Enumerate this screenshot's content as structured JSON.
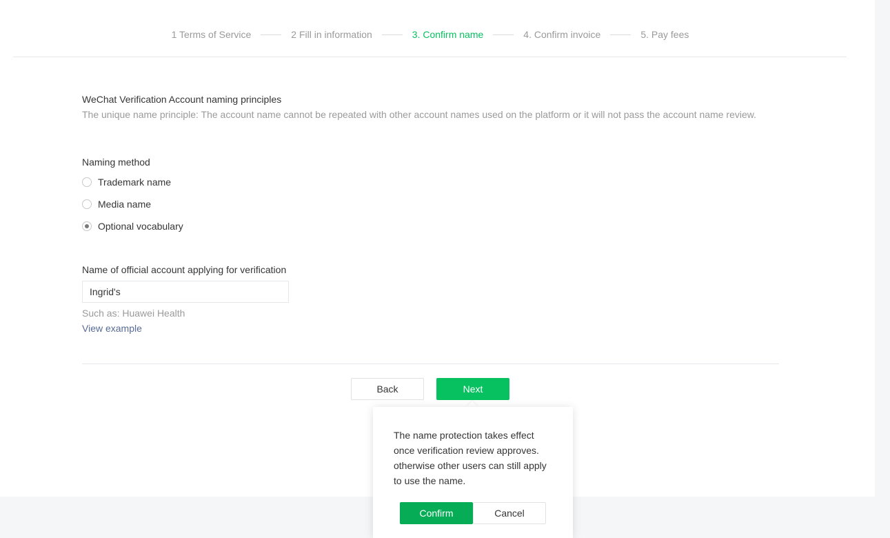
{
  "steps": [
    {
      "label": "1 Terms of Service",
      "active": false
    },
    {
      "label": "2 Fill in information",
      "active": false
    },
    {
      "label": "3. Confirm name",
      "active": true
    },
    {
      "label": "4. Confirm invoice",
      "active": false
    },
    {
      "label": "5. Pay fees",
      "active": false
    }
  ],
  "principles": {
    "title": "WeChat Verification Account naming principles",
    "description": "The unique name principle: The account name cannot be repeated with other account names used on the platform or it will not pass the account name review."
  },
  "naming_method": {
    "label": "Naming method",
    "options": [
      {
        "label": "Trademark name",
        "checked": false
      },
      {
        "label": "Media name",
        "checked": false
      },
      {
        "label": "Optional vocabulary",
        "checked": true
      }
    ]
  },
  "account_name": {
    "label": "Name of official account applying for verification",
    "value": "Ingrid's",
    "hint": "Such as: Huawei Health",
    "example_link": "View example"
  },
  "buttons": {
    "back": "Back",
    "next": "Next"
  },
  "popover": {
    "text": "The name protection takes effect once verification review approves. otherwise other users can still apply to use the name.",
    "confirm": "Confirm",
    "cancel": "Cancel"
  },
  "colors": {
    "accent": "#07c160",
    "link": "#576b95"
  }
}
